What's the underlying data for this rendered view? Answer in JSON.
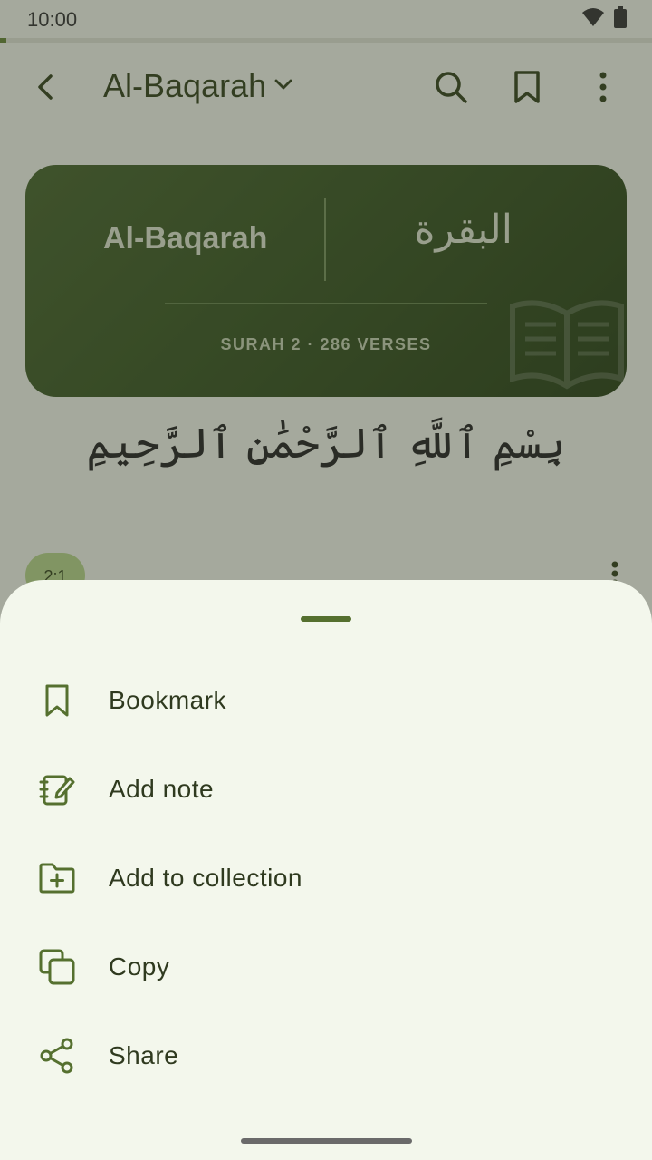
{
  "status_bar": {
    "time": "10:00"
  },
  "reading_progress": 0.01,
  "top_bar": {
    "title": "Al-Baqarah",
    "icons": [
      "back-icon",
      "chevron-down-icon",
      "search-icon",
      "bookmark-icon",
      "more-vert-icon"
    ]
  },
  "surah_card": {
    "name_en": "Al-Baqarah",
    "name_ar": "البقرة",
    "meta": "SURAH 2 · 286 VERSES"
  },
  "bismillah": "بِسْمِ ٱللَّهِ ٱلرَّحْمَٰنِ ٱلرَّحِيمِ",
  "verse": {
    "number": "2:1"
  },
  "sheet": {
    "items": [
      {
        "label": "Bookmark",
        "icon": "bookmark-icon"
      },
      {
        "label": "Add note",
        "icon": "note-icon"
      },
      {
        "label": "Add to collection",
        "icon": "folder-add-icon"
      },
      {
        "label": "Copy",
        "icon": "copy-icon"
      },
      {
        "label": "Share",
        "icon": "share-icon"
      }
    ]
  },
  "colors": {
    "accent": "#55702f",
    "card_bg": "#3f5a2a",
    "sheet_bg": "#f3f7ec",
    "chip_bg": "#b9d58e"
  }
}
